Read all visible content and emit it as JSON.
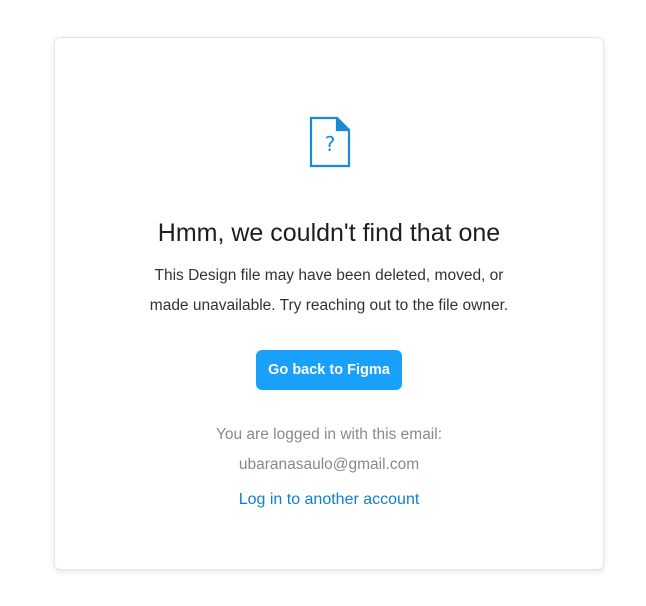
{
  "error_card": {
    "icon": "file-question-icon",
    "icon_glyph": "?",
    "title": "Hmm, we couldn't find that one",
    "description_line1": "This Design file may have been deleted, moved, or",
    "description_line2": "made unavailable. Try reaching out to the file owner.",
    "back_button_label": "Go back to Figma",
    "logged_in_label": "You are logged in with this email:",
    "email": "ubaranasaulo@gmail.com",
    "switch_account_label": "Log in to another account"
  },
  "colors": {
    "accent": "#18a0fb",
    "link": "#0d7fd6",
    "icon": "#1a8ad8",
    "title_text": "#1e1e1e",
    "muted_text": "#8a8a8a"
  }
}
